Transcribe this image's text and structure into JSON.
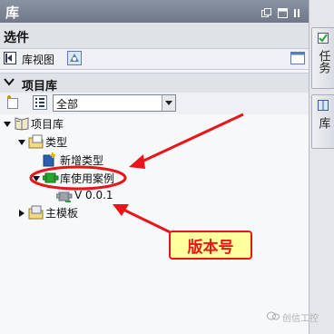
{
  "panel": {
    "title": "库",
    "options_header": "选件",
    "library_view_label": "库视图",
    "project_library_header": "项目库",
    "filter_selected": "全部"
  },
  "tree": {
    "root": "项目库",
    "types": "类型",
    "add_new_type": "新增类型",
    "library_use_case": "库使用案例",
    "version": "V 0.0.1",
    "master_templates": "主模板"
  },
  "side_tabs": {
    "tasks": "任务",
    "libraries": "库"
  },
  "annotation": {
    "callout_text": "版本号",
    "color": "#e8161b",
    "callout_bg": "#ffff9e"
  },
  "watermark": {
    "text": "创信工控"
  }
}
